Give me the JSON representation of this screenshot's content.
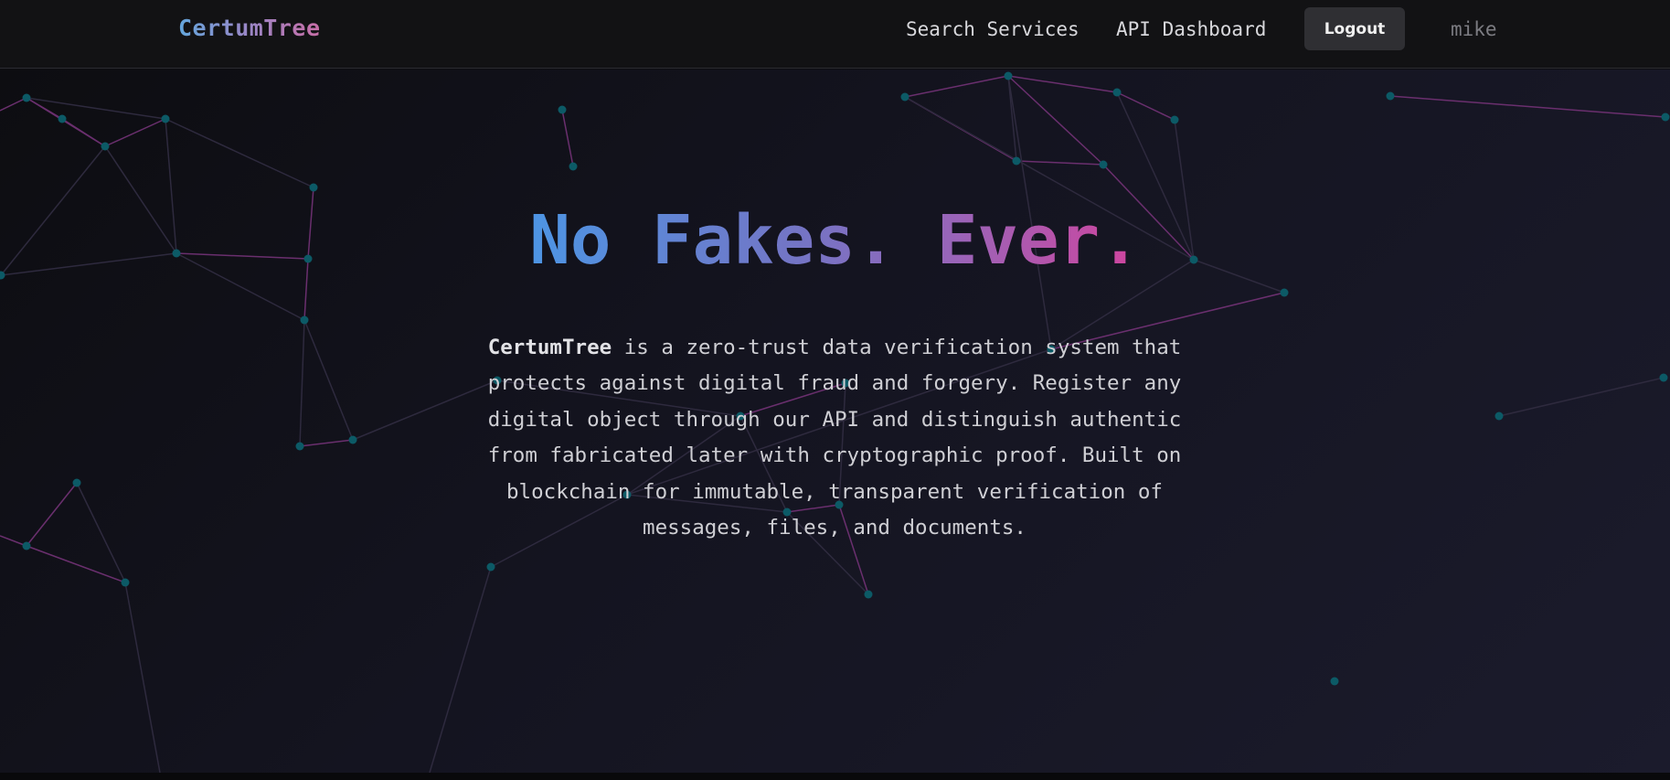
{
  "nav": {
    "brand": "CertumTree",
    "links": [
      "Search Services",
      "API Dashboard"
    ],
    "logout_label": "Logout",
    "username": "mike"
  },
  "hero": {
    "headline": "No Fakes. Ever.",
    "description_brand": "CertumTree",
    "description_rest": " is a zero-trust data verification system that protects against digital fraud and forgery. Register any digital object through our API and distinguish authentic from fabricated later with cryptographic proof. Built on blockchain for immutable, transparent verification of messages, files, and documents."
  },
  "colors": {
    "node": "#0c5a66",
    "edge_pink": "#6a2f6e",
    "edge_gray": "#2e2a3e",
    "headline_start": "#4d95e4",
    "headline_end": "#d0449e"
  }
}
